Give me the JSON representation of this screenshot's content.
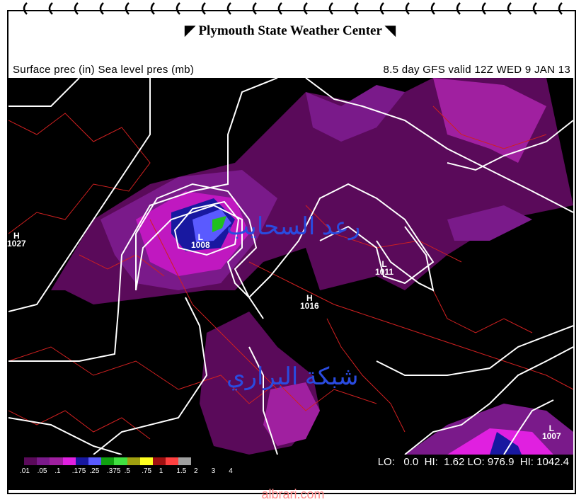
{
  "header": {
    "title": "Plymouth State Weather Center"
  },
  "subtitle": {
    "left": "Surface prec (in) Sea level pres (mb)",
    "right": "8.5 day GFS valid 12Z WED 9 JAN 13"
  },
  "watermarks": [
    "رعد السحايب",
    "شبكة البراري"
  ],
  "pressure_marks": [
    {
      "letter": "H",
      "value": "1027"
    },
    {
      "letter": "L",
      "value": "1008"
    },
    {
      "letter": "L",
      "value": "1011"
    },
    {
      "letter": "H",
      "value": "1016"
    },
    {
      "letter": "L",
      "value": "1007"
    }
  ],
  "legend": {
    "labels": [
      ".01",
      ".05",
      ".1",
      ".175",
      ".25",
      ".375",
      ".5",
      ".75",
      "1",
      "1.5",
      "2",
      "3",
      "4"
    ],
    "colors": [
      "#5a0a5a",
      "#7a1a8a",
      "#a020a0",
      "#e020e0",
      "#1818a0",
      "#5a5aff",
      "#10a010",
      "#40e040",
      "#a0a010",
      "#ffff20",
      "#a01010",
      "#ff4040",
      "#a0a0a0"
    ]
  },
  "stats": {
    "lo_label": "LO:",
    "lo_value": "0.0",
    "hi_label": "HI:",
    "hi_value": "1.62",
    "plo_label": "LO:",
    "plo_value": "976.9",
    "phi_label": "HI:",
    "phi_value": "1042.4"
  },
  "footer": {
    "site": "albrari.com"
  },
  "colors": {
    "background": "#000000",
    "isobar": "#ffffff",
    "borders": "#d02020"
  }
}
